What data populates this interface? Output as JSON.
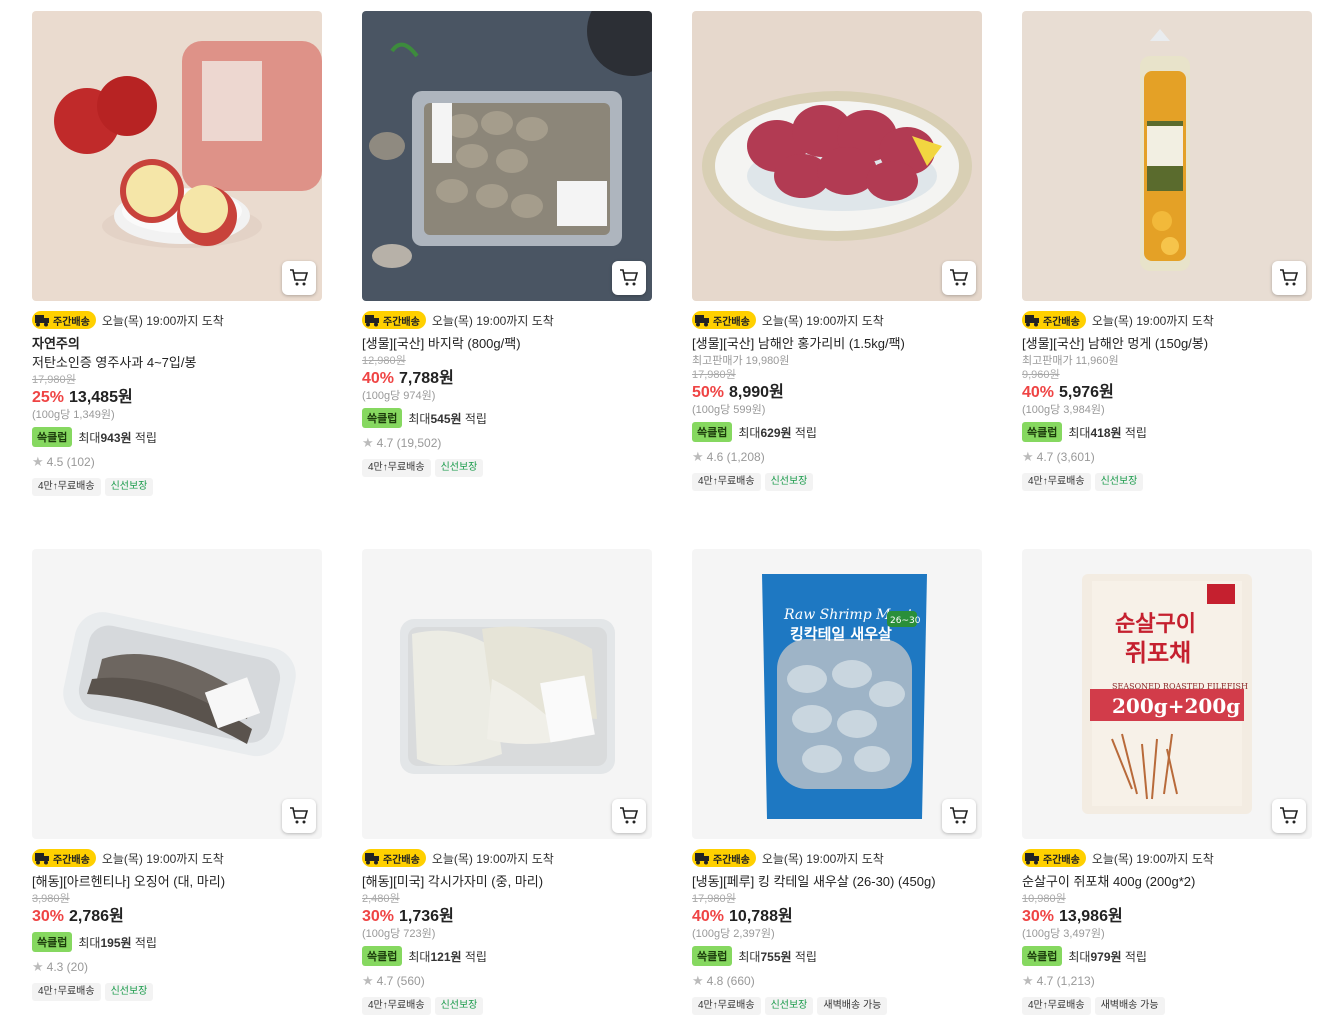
{
  "products": [
    {
      "delivery_badge": "주간배송",
      "arrival": "오늘(목) 19:00까지 도착",
      "brand": "자연주의",
      "title": "저탄소인증 영주사과 4~7입/봉",
      "best_price": "",
      "original_price": "17,980원",
      "discount_rate": "25%",
      "price": "13,485원",
      "unit_price": "(100g당 1,349원)",
      "points_label": "쓱클럽",
      "points_prefix": "최대",
      "points_amount": "943원",
      "points_suffix": "적립",
      "rating": "4.5 (102)",
      "tags": [
        "4만↑무료배송",
        "신선보장"
      ],
      "image": "apples"
    },
    {
      "delivery_badge": "주간배송",
      "arrival": "오늘(목) 19:00까지 도착",
      "brand": "",
      "title": "[생물][국산] 바지락 (800g/팩)",
      "best_price": "",
      "original_price": "12,980원",
      "discount_rate": "40%",
      "price": "7,788원",
      "unit_price": "(100g당 974원)",
      "points_label": "쓱클럽",
      "points_prefix": "최대",
      "points_amount": "545원",
      "points_suffix": "적립",
      "rating": "4.7 (19,502)",
      "tags": [
        "4만↑무료배송",
        "신선보장"
      ],
      "image": "clams"
    },
    {
      "delivery_badge": "주간배송",
      "arrival": "오늘(목) 19:00까지 도착",
      "brand": "",
      "title": "[생물][국산] 남해안 홍가리비 (1.5kg/팩)",
      "best_price": "최고판매가 19,980원",
      "original_price": "17,980원",
      "discount_rate": "50%",
      "price": "8,990원",
      "unit_price": "(100g당 599원)",
      "points_label": "쓱클럽",
      "points_prefix": "최대",
      "points_amount": "629원",
      "points_suffix": "적립",
      "rating": "4.6 (1,208)",
      "tags": [
        "4만↑무료배송",
        "신선보장"
      ],
      "image": "scallops"
    },
    {
      "delivery_badge": "주간배송",
      "arrival": "오늘(목) 19:00까지 도착",
      "brand": "",
      "title": "[생물][국산] 남해안 멍게 (150g/봉)",
      "best_price": "최고판매가 11,960원",
      "original_price": "9,960원",
      "discount_rate": "40%",
      "price": "5,976원",
      "unit_price": "(100g당 3,984원)",
      "points_label": "쓱클럽",
      "points_prefix": "최대",
      "points_amount": "418원",
      "points_suffix": "적립",
      "rating": "4.7 (3,601)",
      "tags": [
        "4만↑무료배송",
        "신선보장"
      ],
      "image": "seasquirt"
    },
    {
      "delivery_badge": "주간배송",
      "arrival": "오늘(목) 19:00까지 도착",
      "brand": "",
      "title": "[해동][아르헨티나] 오징어 (대, 마리)",
      "best_price": "",
      "original_price": "3,980원",
      "discount_rate": "30%",
      "price": "2,786원",
      "unit_price": "",
      "points_label": "쓱클럽",
      "points_prefix": "최대",
      "points_amount": "195원",
      "points_suffix": "적립",
      "rating": "4.3 (20)",
      "tags": [
        "4만↑무료배송",
        "신선보장"
      ],
      "image": "squid"
    },
    {
      "delivery_badge": "주간배송",
      "arrival": "오늘(목) 19:00까지 도착",
      "brand": "",
      "title": "[해동][미국] 각시가자미 (중, 마리)",
      "best_price": "",
      "original_price": "2,480원",
      "discount_rate": "30%",
      "price": "1,736원",
      "unit_price": "(100g당 723원)",
      "points_label": "쓱클럽",
      "points_prefix": "최대",
      "points_amount": "121원",
      "points_suffix": "적립",
      "rating": "4.7 (560)",
      "tags": [
        "4만↑무료배송",
        "신선보장"
      ],
      "image": "flounder"
    },
    {
      "delivery_badge": "주간배송",
      "arrival": "오늘(목) 19:00까지 도착",
      "brand": "",
      "title": "[냉동][페루] 킹 칵테일 새우살 (26-30) (450g)",
      "best_price": "",
      "original_price": "17,980원",
      "discount_rate": "40%",
      "price": "10,788원",
      "unit_price": "(100g당 2,397원)",
      "points_label": "쓱클럽",
      "points_prefix": "최대",
      "points_amount": "755원",
      "points_suffix": "적립",
      "rating": "4.8 (660)",
      "tags": [
        "4만↑무료배송",
        "신선보장",
        "새벽배송 가능"
      ],
      "image": "shrimp",
      "package_text": {
        "line1": "Raw Shrimp Meat",
        "line2": "킹칵테일 새우살",
        "size": "26~30"
      }
    },
    {
      "delivery_badge": "주간배송",
      "arrival": "오늘(목) 19:00까지 도착",
      "brand": "",
      "title": "순살구이 쥐포채 400g (200g*2)",
      "best_price": "",
      "original_price": "10,980원",
      "discount_rate": "30%",
      "price": "13,986원",
      "unit_price": "(100g당 3,497원)",
      "points_label": "쓱클럽",
      "points_prefix": "최대",
      "points_amount": "979원",
      "points_suffix": "적립",
      "rating": "4.7 (1,213)",
      "tags": [
        "4만↑무료배송",
        "새벽배송 가능"
      ],
      "image": "filefish",
      "package_text": {
        "line1": "순살구이",
        "line2": "쥐포채",
        "line3": "SEASONED ROASTED FILEFISH",
        "line4": "200g+200g"
      }
    }
  ],
  "colors": {
    "discount": "#ef4444",
    "badge": "#ffd000",
    "ssg": "#86d860",
    "fresh": "#1a9b4b"
  }
}
